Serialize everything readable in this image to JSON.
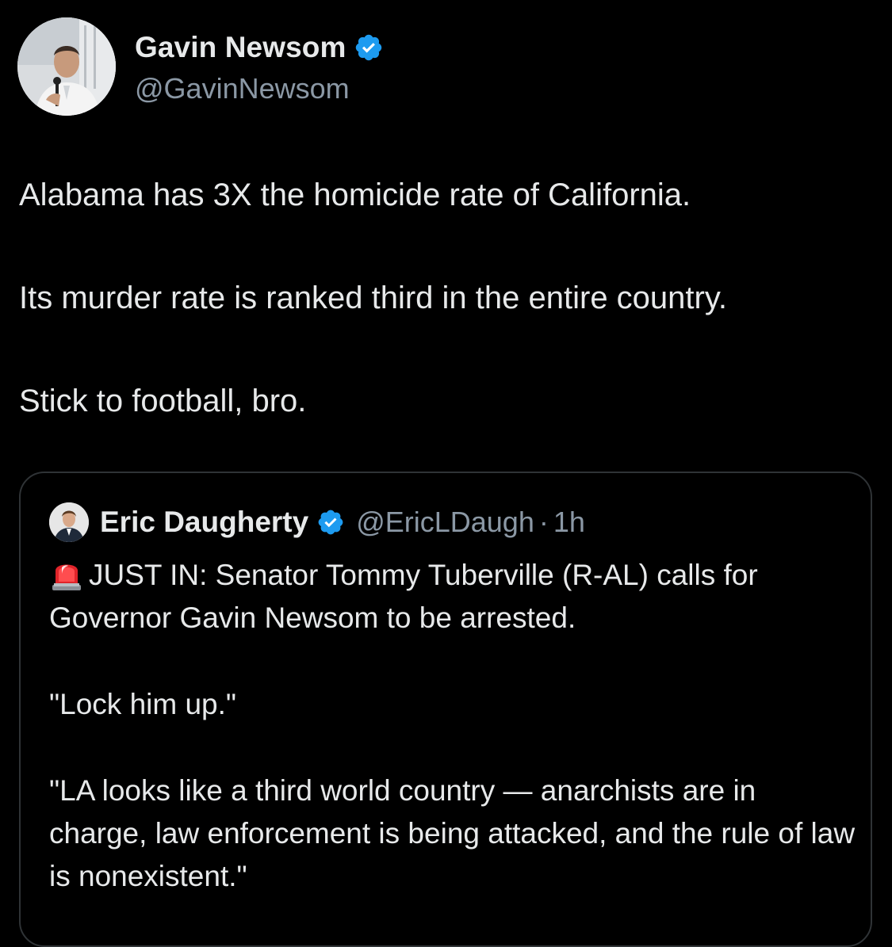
{
  "tweet": {
    "author": {
      "display_name": "Gavin Newsom",
      "handle": "@GavinNewsom",
      "verified": true
    },
    "paragraphs": [
      "Alabama has 3X the homicide rate of California.",
      "Its murder rate is ranked third in the entire country.",
      "Stick to football, bro."
    ]
  },
  "quoted_tweet": {
    "author": {
      "display_name": "Eric Daugherty",
      "handle": "@EricLDaugh",
      "verified": true
    },
    "separator": "·",
    "time": "1h",
    "lead_icon": "siren-emoji",
    "paragraphs": [
      "JUST IN: Senator Tommy Tuberville (R-AL) calls for Governor Gavin Newsom to be arrested.",
      "\"Lock him up.\"",
      "\"LA looks like a third world country — anarchists are in charge, law enforcement is being attacked, and the rule of law is nonexistent.\""
    ]
  },
  "colors": {
    "background": "#000000",
    "text_primary": "#e7e9ea",
    "text_secondary": "#8b98a5",
    "verified_blue": "#1d9bf0",
    "card_border": "#2f3336"
  }
}
